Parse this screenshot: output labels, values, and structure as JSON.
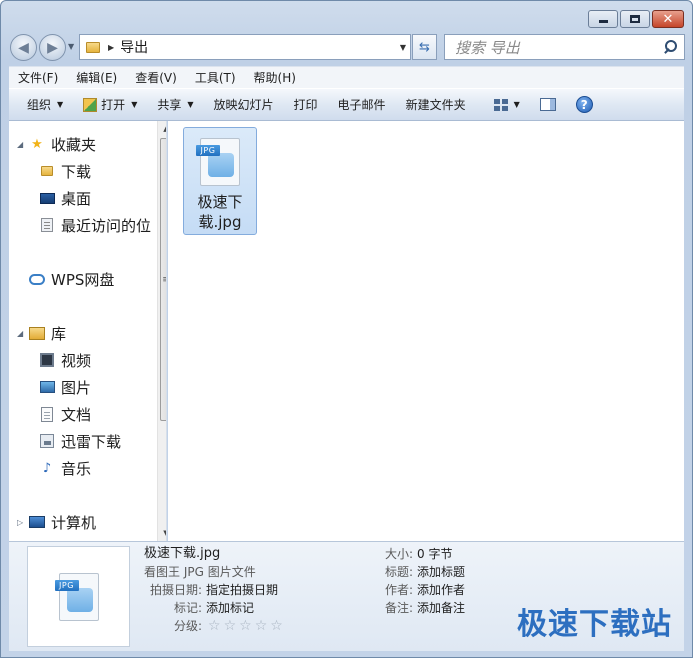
{
  "address": {
    "folder": "导出"
  },
  "search": {
    "placeholder": "搜索 导出"
  },
  "menu": [
    "文件(F)",
    "编辑(E)",
    "查看(V)",
    "工具(T)",
    "帮助(H)"
  ],
  "commands": {
    "organize": "组织",
    "open": "打开",
    "share": "共享",
    "slideshow": "放映幻灯片",
    "print": "打印",
    "email": "电子邮件",
    "new_folder": "新建文件夹"
  },
  "nav": {
    "favorites": "收藏夹",
    "downloads": "下载",
    "desktop": "桌面",
    "recent": "最近访问的位",
    "wps": "WPS网盘",
    "libraries": "库",
    "videos": "视频",
    "pictures": "图片",
    "documents": "文档",
    "thunder": "迅雷下载",
    "music": "音乐",
    "computer": "计算机"
  },
  "file": {
    "name_line1": "极速下",
    "name_line2": "载.jpg",
    "badge": "JPG"
  },
  "details": {
    "filename": "极速下载.jpg",
    "filetype": "看图王 JPG 图片文件",
    "date_label": "拍摄日期:",
    "date_value": "指定拍摄日期",
    "tags_label": "标记:",
    "tags_value": "添加标记",
    "rating_label": "分级:",
    "rating_stars": 0,
    "size_label": "大小:",
    "size_value": "0 字节",
    "title_label": "标题:",
    "title_value": "添加标题",
    "author_label": "作者:",
    "author_value": "添加作者",
    "comment_label": "备注:",
    "comment_value": "添加备注"
  },
  "watermark": "极速下载站"
}
